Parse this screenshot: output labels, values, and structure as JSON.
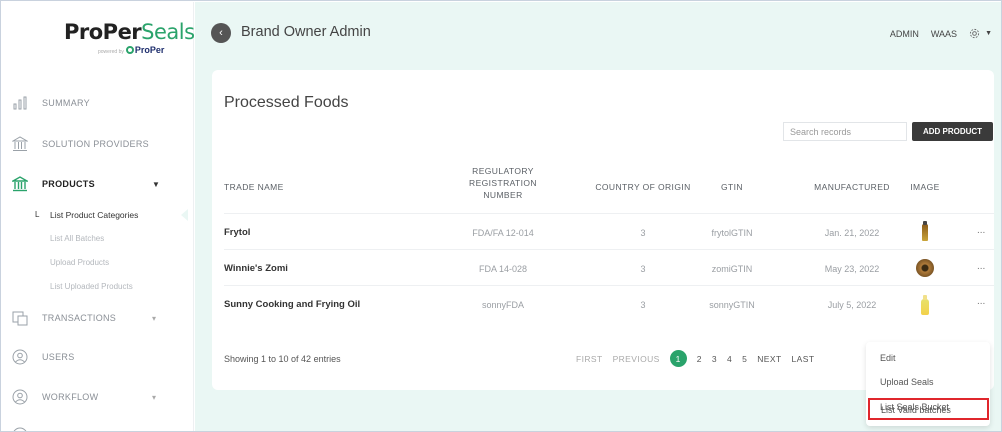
{
  "logo": {
    "part1": "ProPer",
    "part2": "Seals",
    "sub_powered": "powered by",
    "sub_brand": "ProPer"
  },
  "sidebar": {
    "items": [
      {
        "label": "SUMMARY",
        "icon": "bar-chart-icon"
      },
      {
        "label": "SOLUTION PROVIDERS",
        "icon": "institution-icon"
      },
      {
        "label": "PRODUCTS",
        "icon": "institution-icon",
        "expanded": true
      },
      {
        "label": "TRANSACTIONS",
        "icon": "transactions-icon"
      },
      {
        "label": "USERS",
        "icon": "user-circle-icon"
      },
      {
        "label": "WORKFLOW",
        "icon": "user-circle-icon"
      }
    ],
    "sub_marker": "L",
    "subitems": [
      "List Product Categories",
      "List All Batches",
      "Upload Products",
      "List Uploaded Products"
    ],
    "accent_color": "#2aa36b"
  },
  "header": {
    "title": "Brand Owner Admin",
    "admin": "ADMIN",
    "waas": "WAAS",
    "settings_icon": "gear-icon"
  },
  "card": {
    "title": "Processed Foods",
    "search_placeholder": "Search records",
    "add_button": "ADD PRODUCT"
  },
  "table": {
    "columns": [
      "TRADE NAME",
      "REGULATORY REGISTRATION NUMBER",
      "COUNTRY OF ORIGIN",
      "GTIN",
      "MANUFACTURED",
      "IMAGE"
    ],
    "column_lines": [
      "REGULATORY",
      "REGISTRATION",
      "NUMBER"
    ],
    "rows": [
      {
        "trade_name": "Frytol",
        "reg_no": "FDA/FA 12-014",
        "country": "3",
        "gtin": "frytolGTIN",
        "manufactured": "Jan. 21, 2022",
        "image": "oil-bottle"
      },
      {
        "trade_name": "Winnie's Zomi",
        "reg_no": "FDA 14-028",
        "country": "3",
        "gtin": "zomiGTIN",
        "manufactured": "May 23, 2022",
        "image": "oil-tin"
      },
      {
        "trade_name": "Sunny Cooking and Frying Oil",
        "reg_no": "sonnyFDA",
        "country": "3",
        "gtin": "sonnyGTIN",
        "manufactured": "July 5, 2022",
        "image": "oil-bottle-yellow"
      }
    ],
    "more": "..."
  },
  "footer": {
    "showing": "Showing 1 to 10 of 42 entries",
    "first": "FIRST",
    "previous": "PREVIOUS",
    "pages": [
      "1",
      "2",
      "3",
      "4",
      "5"
    ],
    "current_page": "1",
    "next": "NEXT",
    "last": "LAST"
  },
  "dropdown": {
    "items": [
      "Edit",
      "Upload Seals",
      "List Seals Bucket",
      "List Valid batches"
    ],
    "highlighted": "List Valid batches",
    "highlight_color": "#e0262c"
  }
}
